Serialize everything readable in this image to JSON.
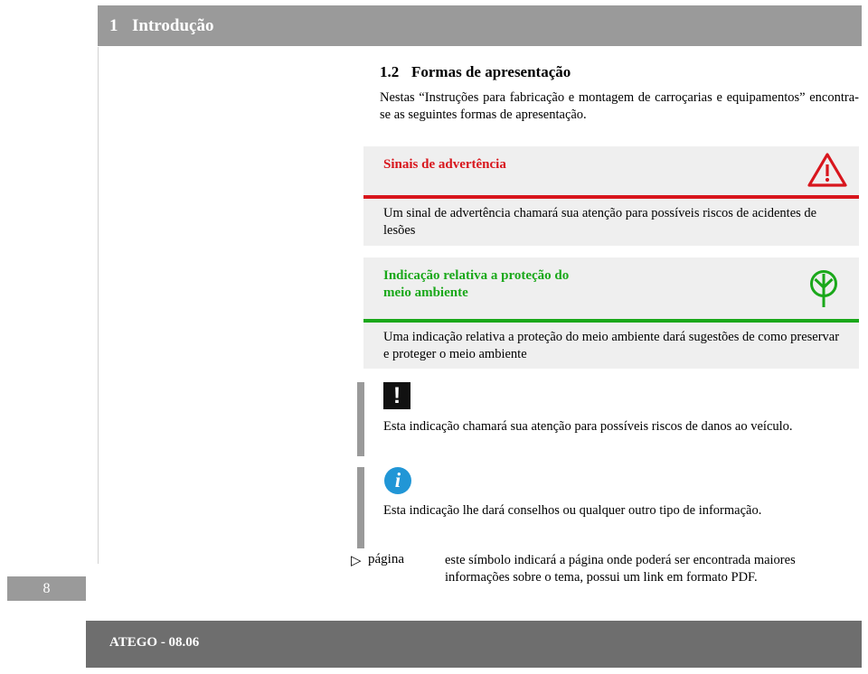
{
  "chapter": {
    "number": "1",
    "title": "Introdução"
  },
  "section": {
    "number": "1.2",
    "title": "Formas de apresentação",
    "intro": "Nestas “Instruções para fabricação e montagem de carroçarias e equipamentos” encontra-se as seguintes formas de apresentação."
  },
  "panels": {
    "warning": {
      "icon": "warning-triangle-icon",
      "heading": "Sinais de advertência",
      "body": "Um sinal de advertência chamará sua atenção para possíveis riscos de acidentes de lesões",
      "accent_color": "#d8161d",
      "background_color": "#efefef"
    },
    "environment": {
      "icon": "tree-icon",
      "heading_line1": "Indicação relativa a proteção do",
      "heading_line2": "meio ambiente",
      "body": "Uma indicação relativa a proteção do meio ambiente dará sugestões de como preservar e proteger o meio ambiente",
      "accent_color": "#1aa81a",
      "background_color": "#efefef"
    }
  },
  "notes": [
    {
      "icon": "exclamation-box-icon",
      "icon_glyph": "!",
      "text": "Esta indicação chamará sua atenção para possíveis riscos de danos ao veículo."
    },
    {
      "icon": "info-circle-icon",
      "icon_glyph": "i",
      "text": "Esta indicação lhe dará conselhos ou qualquer outro tipo de informação.",
      "icon_color": "#2196d6"
    }
  ],
  "page_reference": {
    "marker": "▷",
    "label": "página",
    "text": "este símbolo indicará a página onde poderá ser encontrada maiores informações sobre o tema, possui um link em formato PDF."
  },
  "page_number": "8",
  "footer": {
    "text": "ATEGO - 08.06"
  }
}
